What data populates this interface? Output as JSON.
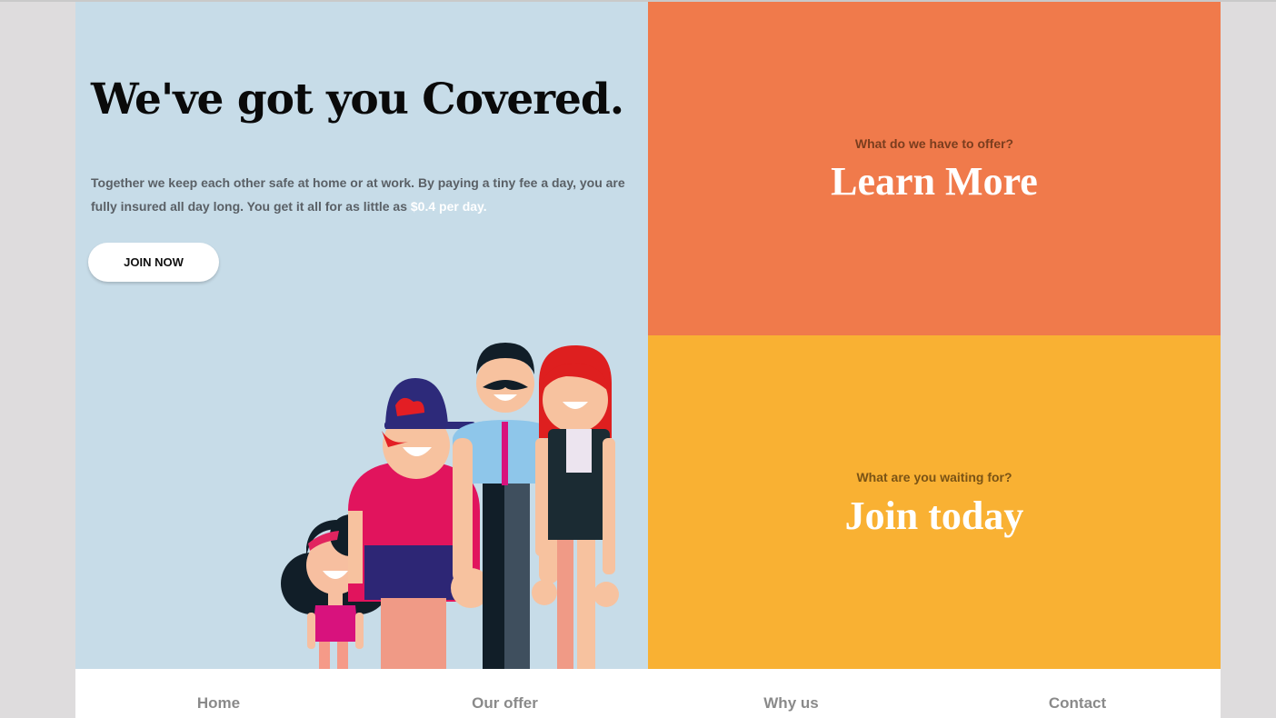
{
  "hero": {
    "headline": "We've got you Covered.",
    "lead_text": "Together we keep each other safe at home or at work. By paying a tiny fee a day, you are fully insured all day long. You get it all for as little as ",
    "lead_highlight": "$0.4 per day.",
    "join_button_label": "JOIN NOW"
  },
  "offer_panel": {
    "kicker": "What do we have to offer?",
    "cta": "Learn More"
  },
  "join_panel": {
    "kicker": "What are you waiting for?",
    "cta": "Join today"
  },
  "nav": {
    "home": "Home",
    "our_offer": "Our offer",
    "why_us": "Why us",
    "contact": "Contact"
  },
  "colors": {
    "hero_bg": "#c7dce8",
    "offer_bg": "#f07a4b",
    "join_bg": "#f9b133",
    "nav_text": "#8a8a8a"
  },
  "icons": {
    "illustration": "family-illustration"
  }
}
